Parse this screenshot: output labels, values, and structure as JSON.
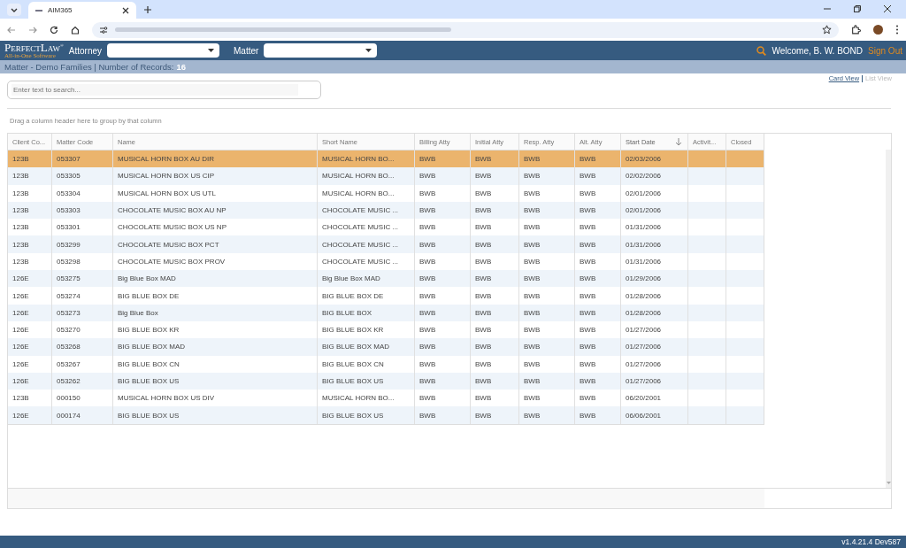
{
  "browser": {
    "tab_title": "AIM365"
  },
  "header": {
    "logo_top": "PerfectLaw",
    "logo_bottom": "All-in-One Software",
    "logo_mark": "®",
    "attorney_label": "Attorney",
    "matter_label": "Matter",
    "welcome": "Welcome, B. W. BOND",
    "sign_out": "Sign Out"
  },
  "subheader": {
    "title": "Matter - Demo Families | Number of Records:",
    "count": "16"
  },
  "search": {
    "placeholder": "Enter text to search..."
  },
  "views": [
    {
      "label": "Card View",
      "selected": false
    },
    {
      "label": "List View",
      "selected": true
    }
  ],
  "group_hint": "Drag a column header here to group by that column",
  "table": {
    "columns": [
      {
        "label": "Client Co...",
        "sorted": false
      },
      {
        "label": "Matter Code",
        "sorted": false
      },
      {
        "label": "Name",
        "sorted": false
      },
      {
        "label": "Short Name",
        "sorted": false
      },
      {
        "label": "Billing Atty",
        "sorted": false
      },
      {
        "label": "Initial Atty",
        "sorted": false
      },
      {
        "label": "Resp. Atty",
        "sorted": false
      },
      {
        "label": "Alt. Atty",
        "sorted": false
      },
      {
        "label": "Start Date",
        "sorted": true
      },
      {
        "label": "Activit...",
        "sorted": false
      },
      {
        "label": "Closed",
        "sorted": false
      }
    ],
    "rows": [
      {
        "selected": true,
        "cells": [
          "123B",
          "053307",
          "MUSICAL HORN BOX AU DIR",
          "MUSICAL HORN BO...",
          "BWB",
          "BWB",
          "BWB",
          "BWB",
          "02/03/2006"
        ]
      },
      {
        "selected": false,
        "cells": [
          "123B",
          "053305",
          "MUSICAL HORN BOX US CIP",
          "MUSICAL HORN BO...",
          "BWB",
          "BWB",
          "BWB",
          "BWB",
          "02/02/2006"
        ]
      },
      {
        "selected": false,
        "cells": [
          "123B",
          "053304",
          "MUSICAL HORN BOX US UTL",
          "MUSICAL HORN BO...",
          "BWB",
          "BWB",
          "BWB",
          "BWB",
          "02/01/2006"
        ]
      },
      {
        "selected": false,
        "cells": [
          "123B",
          "053303",
          "CHOCOLATE MUSIC BOX AU NP",
          "CHOCOLATE MUSIC ...",
          "BWB",
          "BWB",
          "BWB",
          "BWB",
          "02/01/2006"
        ]
      },
      {
        "selected": false,
        "cells": [
          "123B",
          "053301",
          "CHOCOLATE MUSIC BOX US NP",
          "CHOCOLATE MUSIC ...",
          "BWB",
          "BWB",
          "BWB",
          "BWB",
          "01/31/2006"
        ]
      },
      {
        "selected": false,
        "cells": [
          "123B",
          "053299",
          "CHOCOLATE MUSIC BOX PCT",
          "CHOCOLATE MUSIC ...",
          "BWB",
          "BWB",
          "BWB",
          "BWB",
          "01/31/2006"
        ]
      },
      {
        "selected": false,
        "cells": [
          "123B",
          "053298",
          "CHOCOLATE MUSIC BOX PROV",
          "CHOCOLATE MUSIC ...",
          "BWB",
          "BWB",
          "BWB",
          "BWB",
          "01/31/2006"
        ]
      },
      {
        "selected": false,
        "cells": [
          "126E",
          "053275",
          "Big Blue Box MAD",
          "Big Blue Box MAD",
          "BWB",
          "BWB",
          "BWB",
          "BWB",
          "01/29/2006"
        ]
      },
      {
        "selected": false,
        "cells": [
          "126E",
          "053274",
          "BIG BLUE BOX DE",
          "BIG BLUE BOX DE",
          "BWB",
          "BWB",
          "BWB",
          "BWB",
          "01/28/2006"
        ]
      },
      {
        "selected": false,
        "cells": [
          "126E",
          "053273",
          "Big Blue Box",
          "BIG BLUE BOX",
          "BWB",
          "BWB",
          "BWB",
          "BWB",
          "01/28/2006"
        ]
      },
      {
        "selected": false,
        "cells": [
          "126E",
          "053270",
          "BIG BLUE BOX KR",
          "BIG BLUE BOX KR",
          "BWB",
          "BWB",
          "BWB",
          "BWB",
          "01/27/2006"
        ]
      },
      {
        "selected": false,
        "cells": [
          "126E",
          "053268",
          "BIG BLUE BOX MAD",
          "BIG BLUE BOX MAD",
          "BWB",
          "BWB",
          "BWB",
          "BWB",
          "01/27/2006"
        ]
      },
      {
        "selected": false,
        "cells": [
          "126E",
          "053267",
          "BIG BLUE BOX CN",
          "BIG BLUE BOX CN",
          "BWB",
          "BWB",
          "BWB",
          "BWB",
          "01/27/2006"
        ]
      },
      {
        "selected": false,
        "cells": [
          "126E",
          "053262",
          "BIG BLUE BOX US",
          "BIG BLUE BOX US",
          "BWB",
          "BWB",
          "BWB",
          "BWB",
          "01/27/2006"
        ]
      },
      {
        "selected": false,
        "cells": [
          "123B",
          "000150",
          "MUSICAL HORN BOX US DIV",
          "MUSICAL HORN BO...",
          "BWB",
          "BWB",
          "BWB",
          "BWB",
          "06/20/2001"
        ]
      },
      {
        "selected": false,
        "cells": [
          "126E",
          "000174",
          "BIG BLUE BOX US",
          "BIG BLUE BOX US",
          "BWB",
          "BWB",
          "BWB",
          "BWB",
          "06/06/2001"
        ]
      }
    ]
  },
  "status_bar": {
    "version": "v1.4.21.4 Dev587"
  }
}
